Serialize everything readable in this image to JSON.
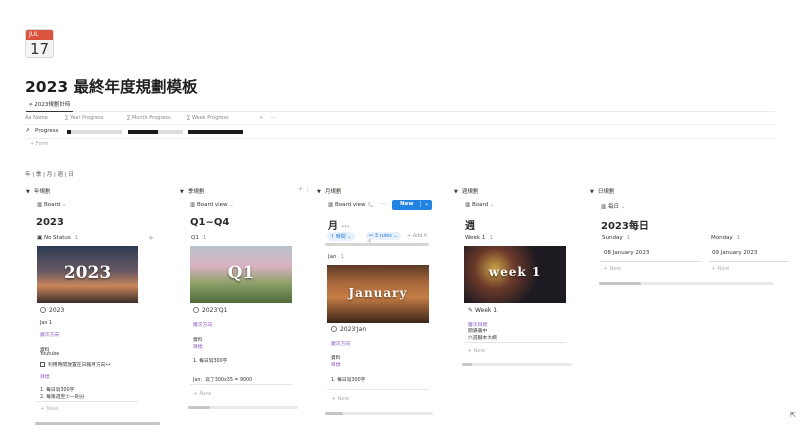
{
  "page": {
    "calendar_icon": {
      "month": "JUL",
      "day": "17"
    },
    "title": "2023 最終年度規劃模板",
    "tab": "2023規劃計時",
    "properties": [
      "Name",
      "Year Progress",
      "Month Progress",
      "Week Progress"
    ],
    "progress_row_label": "Progress",
    "progress": {
      "year": 0.08,
      "month": 0.55,
      "week": 1.0
    },
    "formula_label": "+ Form",
    "view_switch": "年 | 季 | 月 | 週 | 日"
  },
  "columns": {
    "year": {
      "header": "年規劃",
      "view": "Board",
      "heading": "2023",
      "group": "No Status",
      "group_count": "1",
      "cover_text": "2023",
      "card_title": "2023",
      "card_lines": [
        "Jan 1"
      ],
      "link": "層次方向",
      "section1_label": "資料",
      "section1_value": "Youtube",
      "todo": "利用時間放置在日報月方向👀",
      "section2_label": "目標",
      "list": [
        "1. 每日寫300字",
        "2. 每兩週至少一則分"
      ],
      "new": "New"
    },
    "quarter": {
      "header": "季規劃",
      "view": "Board view",
      "heading": "Q1~Q4",
      "group": "Q1",
      "group_count": "1",
      "cover_text": "Q1",
      "card_title": "2023'Q1",
      "link": "層次方向",
      "link2": "目標",
      "section_label": "資料",
      "item": "1. 每日寫300字",
      "footer_text": "Jan：寫了300x35 = 9000",
      "new": "New"
    },
    "month": {
      "header": "月規劃",
      "view": "Board view",
      "new_button": "New",
      "heading": "月",
      "chip_date": "時間",
      "chip_rules": "3 rules",
      "add_filter": "+ Add fi",
      "group": "Jan",
      "group_count": "1",
      "cover_text": "January",
      "card_title": "2023'Jan",
      "link": "層次方向",
      "section_label": "資料",
      "link2": "目標",
      "item": "1. 每日寫300字",
      "new": "New"
    },
    "week": {
      "header": "週規劃",
      "view": "Board",
      "heading": "週",
      "group": "Week 1",
      "group_count": "1",
      "cover_text": "week 1",
      "card_title": "Week 1",
      "link": "層次目標",
      "lines": [
        "閱讀書中",
        "六週腳本大綱"
      ],
      "new": "New"
    },
    "day": {
      "header": "日規劃",
      "view": "每日",
      "heading": "2023每日",
      "groups": [
        {
          "name": "Sunday",
          "count": "1",
          "date": "08 January 2023"
        },
        {
          "name": "Monday",
          "count": "1",
          "date": "09 January 2023"
        }
      ],
      "new": "New"
    }
  },
  "colors": {
    "accent": "#2383e2",
    "link": "#8a5cc9",
    "text": "#37352f"
  }
}
